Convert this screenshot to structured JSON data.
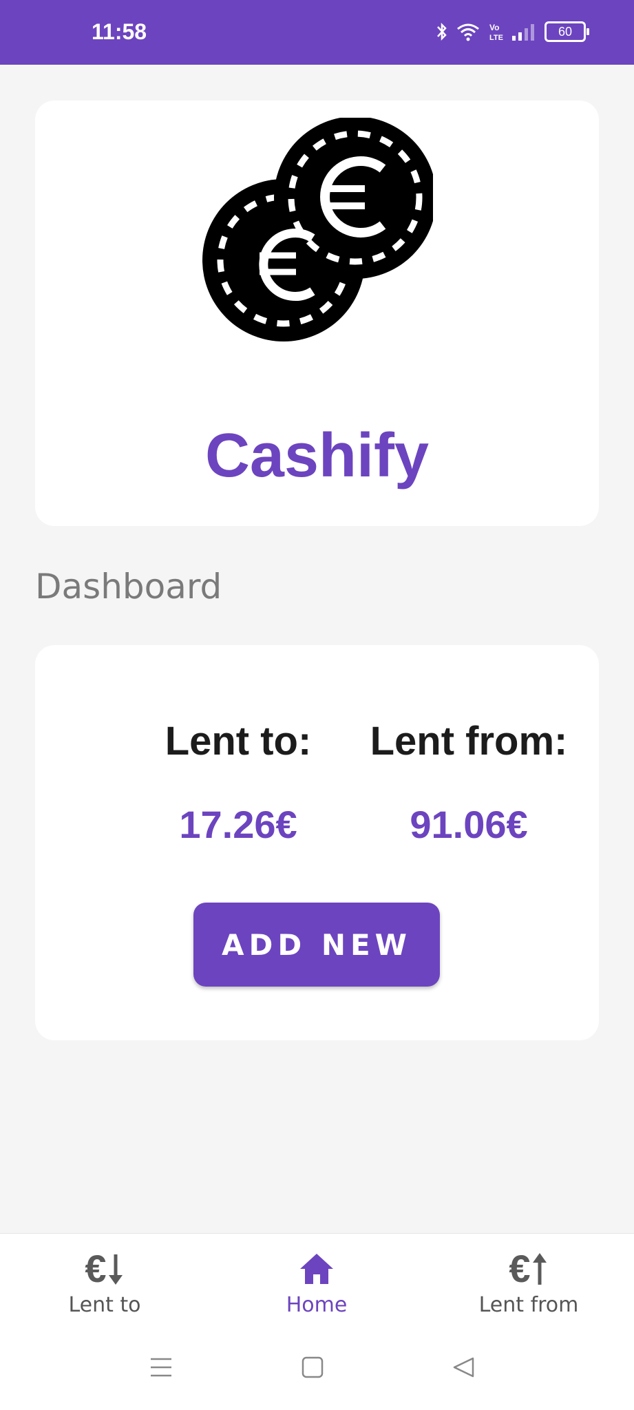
{
  "status_bar": {
    "time": "11:58",
    "battery": "60",
    "icons": [
      "bluetooth-icon",
      "wifi-icon",
      "volte-icon",
      "signal-icon",
      "battery-icon"
    ]
  },
  "header_card": {
    "logo_icon": "euro-coins-icon",
    "app_title": "Cashify"
  },
  "section_label": "Dashboard",
  "dashboard": {
    "lent_to_label": "Lent to:",
    "lent_to_value": "17.26€",
    "lent_from_label": "Lent from:",
    "lent_from_value": "91.06€",
    "add_button_label": "ADD NEW"
  },
  "bottom_nav": {
    "items": [
      {
        "label": "Lent to",
        "icon": "euro-arrow-down-icon",
        "glyph": "€",
        "active": false
      },
      {
        "label": "Home",
        "icon": "home-icon",
        "active": true
      },
      {
        "label": "Lent from",
        "icon": "euro-arrow-up-icon",
        "glyph": "€",
        "active": false
      }
    ]
  },
  "system_nav": {
    "buttons": [
      "menu-icon",
      "home-square-icon",
      "back-triangle-icon"
    ]
  },
  "colors": {
    "accent": "#6c44bf",
    "background": "#f5f5f5",
    "card": "#ffffff"
  }
}
